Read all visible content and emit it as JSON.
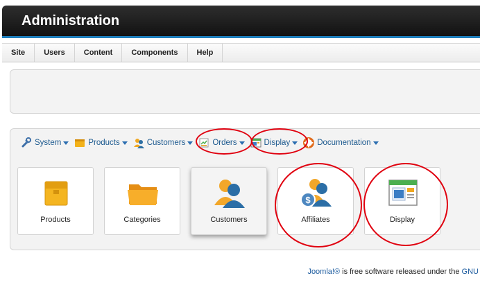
{
  "header": {
    "title": "Administration"
  },
  "menu": [
    "Site",
    "Users",
    "Content",
    "Components",
    "Help"
  ],
  "toolbar": {
    "system": "System",
    "products": "Products",
    "customers": "Customers",
    "orders": "Orders",
    "display": "Display",
    "documentation": "Documentation"
  },
  "tiles": {
    "products": "Products",
    "categories": "Categories",
    "customers": "Customers",
    "affiliates": "Affiliates",
    "display": "Display"
  },
  "footer": {
    "link1": "Joomla!®",
    "text": " is free software released under the ",
    "link2": "GNU"
  },
  "colors": {
    "accent": "#1e7fbd",
    "annotation": "#e0000f",
    "link": "#1d5a8f"
  }
}
